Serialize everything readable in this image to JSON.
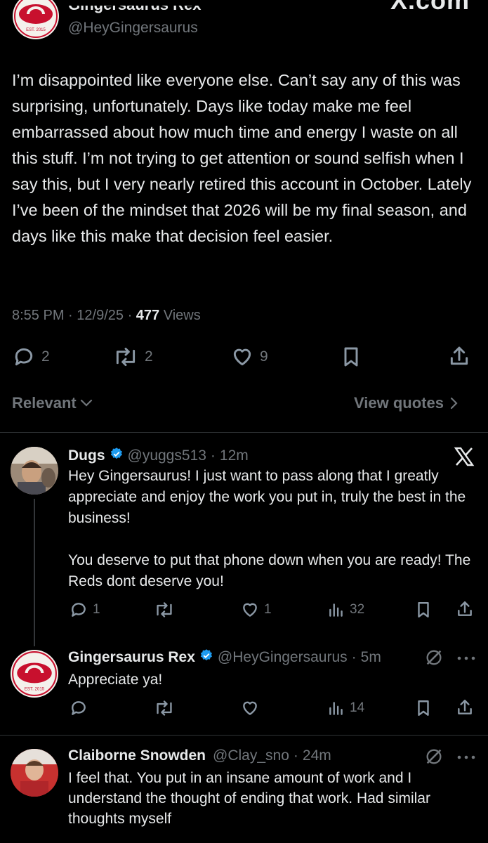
{
  "top": {
    "author_name": "Gingersaurus Rex",
    "author_handle": "@HeyGingersaurus",
    "watermark": "X.com"
  },
  "main_post": {
    "text": "I’m disappointed like everyone else. Can’t say any of this was surprising, unfortunately. Days like today make me feel embarrassed about how much time and energy I waste on all this stuff. I’m not trying to get attention or sound selfish when I say this, but I very nearly retired this account in October. Lately I’ve been of the mindset that 2026 will be my final season, and days like this make that decision feel easier.",
    "time": "8:55 PM",
    "date": "12/9/25",
    "views_count": "477",
    "views_label": "Views",
    "replies": "2",
    "reposts": "2",
    "likes": "9"
  },
  "filter": {
    "relevant_label": "Relevant",
    "view_quotes_label": "View quotes"
  },
  "replies": [
    {
      "name": "Dugs",
      "handle": "@yuggs513",
      "time": "12m",
      "text": "Hey Gingersaurus! I just want to pass along that I greatly appreciate and enjoy the work you put in, truly the best in the business!\n\nYou deserve to put that phone down when you are ready! The Reds dont deserve you!",
      "replies": "1",
      "reposts": "",
      "likes": "1",
      "views": "32"
    },
    {
      "name": "Gingersaurus Rex",
      "handle": "@HeyGingersaurus",
      "time": "5m",
      "text": "Appreciate ya!",
      "replies": "",
      "reposts": "",
      "likes": "",
      "views": "14"
    },
    {
      "name": "Claiborne Snowden",
      "handle": "@Clay_sno",
      "time": "24m",
      "text": "I feel that. You put in an insane amount of work and I understand the thought of ending that work. Had similar thoughts myself"
    }
  ],
  "colors": {
    "background": "#000000",
    "text": "#e7e9ea",
    "muted": "#71767b",
    "verified": "#1d9bf0",
    "logo_red": "#c8102e"
  },
  "logo_text": {
    "est": "EST. 2015"
  }
}
